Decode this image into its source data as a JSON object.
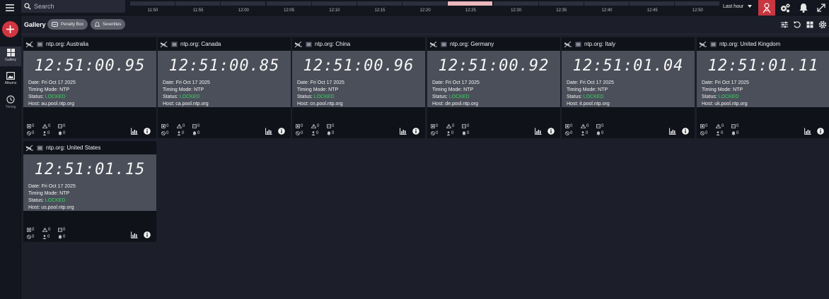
{
  "topbar": {
    "search_placeholder": "Search",
    "timeline_ticks": [
      "11:50",
      "11:55",
      "12:00",
      "12:05",
      "12:10",
      "12:15",
      "12:20",
      "12:25",
      "12:30",
      "12:35",
      "12:40",
      "12:45",
      "12:50"
    ],
    "range_label": "Last hour",
    "user_color": "#c8363f"
  },
  "sidebar": {
    "add_color": "#d13640",
    "items": [
      {
        "label": "Gallery",
        "icon": "grid-icon"
      },
      {
        "label": "Albums",
        "icon": "image-icon"
      },
      {
        "label": "Timing",
        "icon": "clock-icon"
      }
    ]
  },
  "header": {
    "title": "Gallery",
    "chip_penalty": "Penalty Box",
    "chip_severities": "Severities"
  },
  "labels": {
    "date": "Date:",
    "mode": "Timing Mode:",
    "status": "Status:",
    "host": "Host:"
  },
  "status_color": "#37d65f",
  "cameras": [
    {
      "title": "ntp.org: Australia",
      "clock": "12:51:00.95",
      "date": "Fri Oct 17 2025",
      "mode": "NTP",
      "status": "LOCKED",
      "host": "au.pool.ntp.org",
      "stats": [
        "0",
        "0",
        "0",
        "0",
        "0",
        "0"
      ]
    },
    {
      "title": "ntp.org: Canada",
      "clock": "12:51:00.85",
      "date": "Fri Oct 17 2025",
      "mode": "NTP",
      "status": "LOCKED",
      "host": "ca.pool.ntp.org",
      "stats": [
        "0",
        "0",
        "0",
        "0",
        "0",
        "0"
      ]
    },
    {
      "title": "ntp.org: China",
      "clock": "12:51:00.96",
      "date": "Fri Oct 17 2025",
      "mode": "NTP",
      "status": "LOCKED",
      "host": "cn.pool.ntp.org",
      "stats": [
        "0",
        "0",
        "0",
        "0",
        "0",
        "0"
      ]
    },
    {
      "title": "ntp.org: Germany",
      "clock": "12:51:00.92",
      "date": "Fri Oct 17 2025",
      "mode": "NTP",
      "status": "LOCKED",
      "host": "de.pool.ntp.org",
      "stats": [
        "0",
        "0",
        "0",
        "0",
        "0",
        "0"
      ]
    },
    {
      "title": "ntp.org: Italy",
      "clock": "12:51:01.04",
      "date": "Fri Oct 17 2025",
      "mode": "NTP",
      "status": "LOCKED",
      "host": "it.pool.ntp.org",
      "stats": [
        "0",
        "0",
        "0",
        "0",
        "0",
        "0"
      ]
    },
    {
      "title": "ntp.org: United Kingdom",
      "clock": "12:51:01.11",
      "date": "Fri Oct 17 2025",
      "mode": "NTP",
      "status": "LOCKED",
      "host": "uk.pool.ntp.org",
      "stats": [
        "0",
        "0",
        "0",
        "0",
        "0",
        "0"
      ]
    },
    {
      "title": "ntp.org: United States",
      "clock": "12:51:01.15",
      "date": "Fri Oct 17 2025",
      "mode": "NTP",
      "status": "LOCKED",
      "host": "us.pool.ntp.org",
      "stats": [
        "0",
        "0",
        "0",
        "0",
        "0",
        "0"
      ]
    }
  ]
}
